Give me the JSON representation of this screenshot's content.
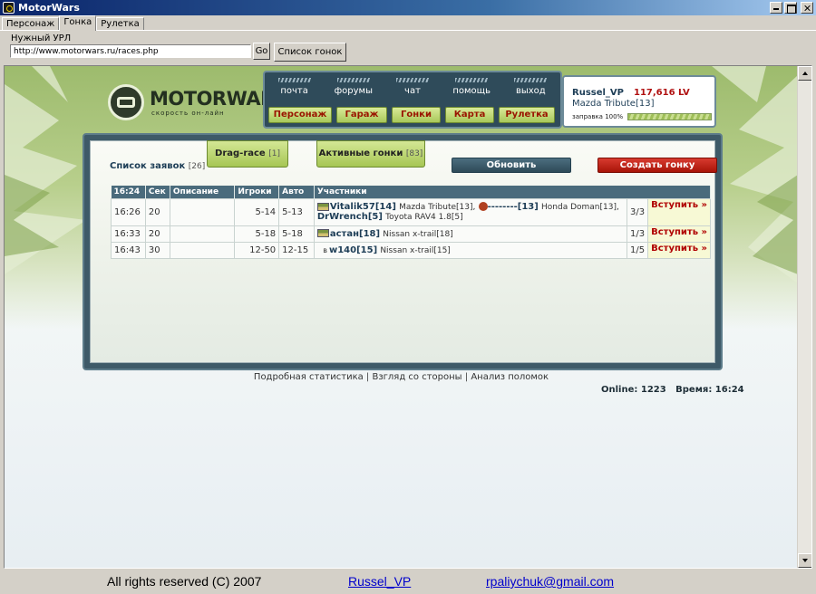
{
  "window": {
    "title": "MotorWars"
  },
  "tabs": [
    {
      "label": "Персонаж"
    },
    {
      "label": "Гонка"
    },
    {
      "label": "Рулетка"
    }
  ],
  "url_bar": {
    "label": "Нужный УРЛ",
    "value": "http://www.motorwars.ru/races.php",
    "go_label": "Go",
    "list_label": "Список гонок"
  },
  "site": {
    "logo": "MOTORWARS.RU",
    "tagline": "скорость он-лайн",
    "nav_top": [
      "почта",
      "форумы",
      "чат",
      "помощь",
      "выход"
    ],
    "nav_buttons": [
      "Персонаж",
      "Гараж",
      "Гонки",
      "Карта",
      "Рулетка"
    ],
    "user": {
      "name": "Russel_VP",
      "money": "117,616 LV",
      "car": "Mazda Tribute[13]",
      "fuel_label": "заправка 100%",
      "fuel_percent": 100
    }
  },
  "races_panel": {
    "title": "Список заявок",
    "title_count": "[26]",
    "tab_drag": "Drag-race",
    "tab_drag_count": "[1]",
    "tab_active": "Активные гонки",
    "tab_active_count": "[83]",
    "refresh_label": "Обновить",
    "create_label": "Создать гонку",
    "columns": [
      "16:24",
      "Сек",
      "Описание",
      "Игроки",
      "Авто",
      "Участники"
    ],
    "rows": [
      {
        "time": "16:26",
        "sec": "20",
        "desc": "",
        "players": "5-14",
        "auto": "5-13",
        "p1_name": "Vitalik57",
        "p1_level": "[14]",
        "p1_car": "Mazda Tribute[13],",
        "p2_name": "--------",
        "p2_level": "[13]",
        "p2_car": "Honda Doman[13],",
        "p3_name": "DrWrench",
        "p3_level": "[5]",
        "p3_car": "Toyota RAV4 1.8[5]",
        "slots": "3/3",
        "join": "Вступить »"
      },
      {
        "time": "16:33",
        "sec": "20",
        "desc": "",
        "players": "5-18",
        "auto": "5-18",
        "p1_name": "астан",
        "p1_level": "[18]",
        "p1_car": "Nissan x-trail[18]",
        "slots": "1/3",
        "join": "Вступить »"
      },
      {
        "time": "16:43",
        "sec": "30",
        "desc": "",
        "players": "12-50",
        "auto": "12-15",
        "p1_prefix": "в",
        "p1_name": "w140",
        "p1_level": "[15]",
        "p1_car": "Nissan x-trail[15]",
        "slots": "1/5",
        "join": "Вступить »"
      }
    ]
  },
  "footer": {
    "link_stats": "Подробная статистика",
    "link_view": "Взгляд со стороны",
    "link_breaks": "Анализ поломок",
    "sep": "|",
    "online": "Online: 1223",
    "time": "Время: 16:24"
  },
  "bottom": {
    "copyright": "All rights reserved (C) 2007",
    "author": "Russel_VP",
    "email": "rpaliychuk@gmail.com"
  }
}
